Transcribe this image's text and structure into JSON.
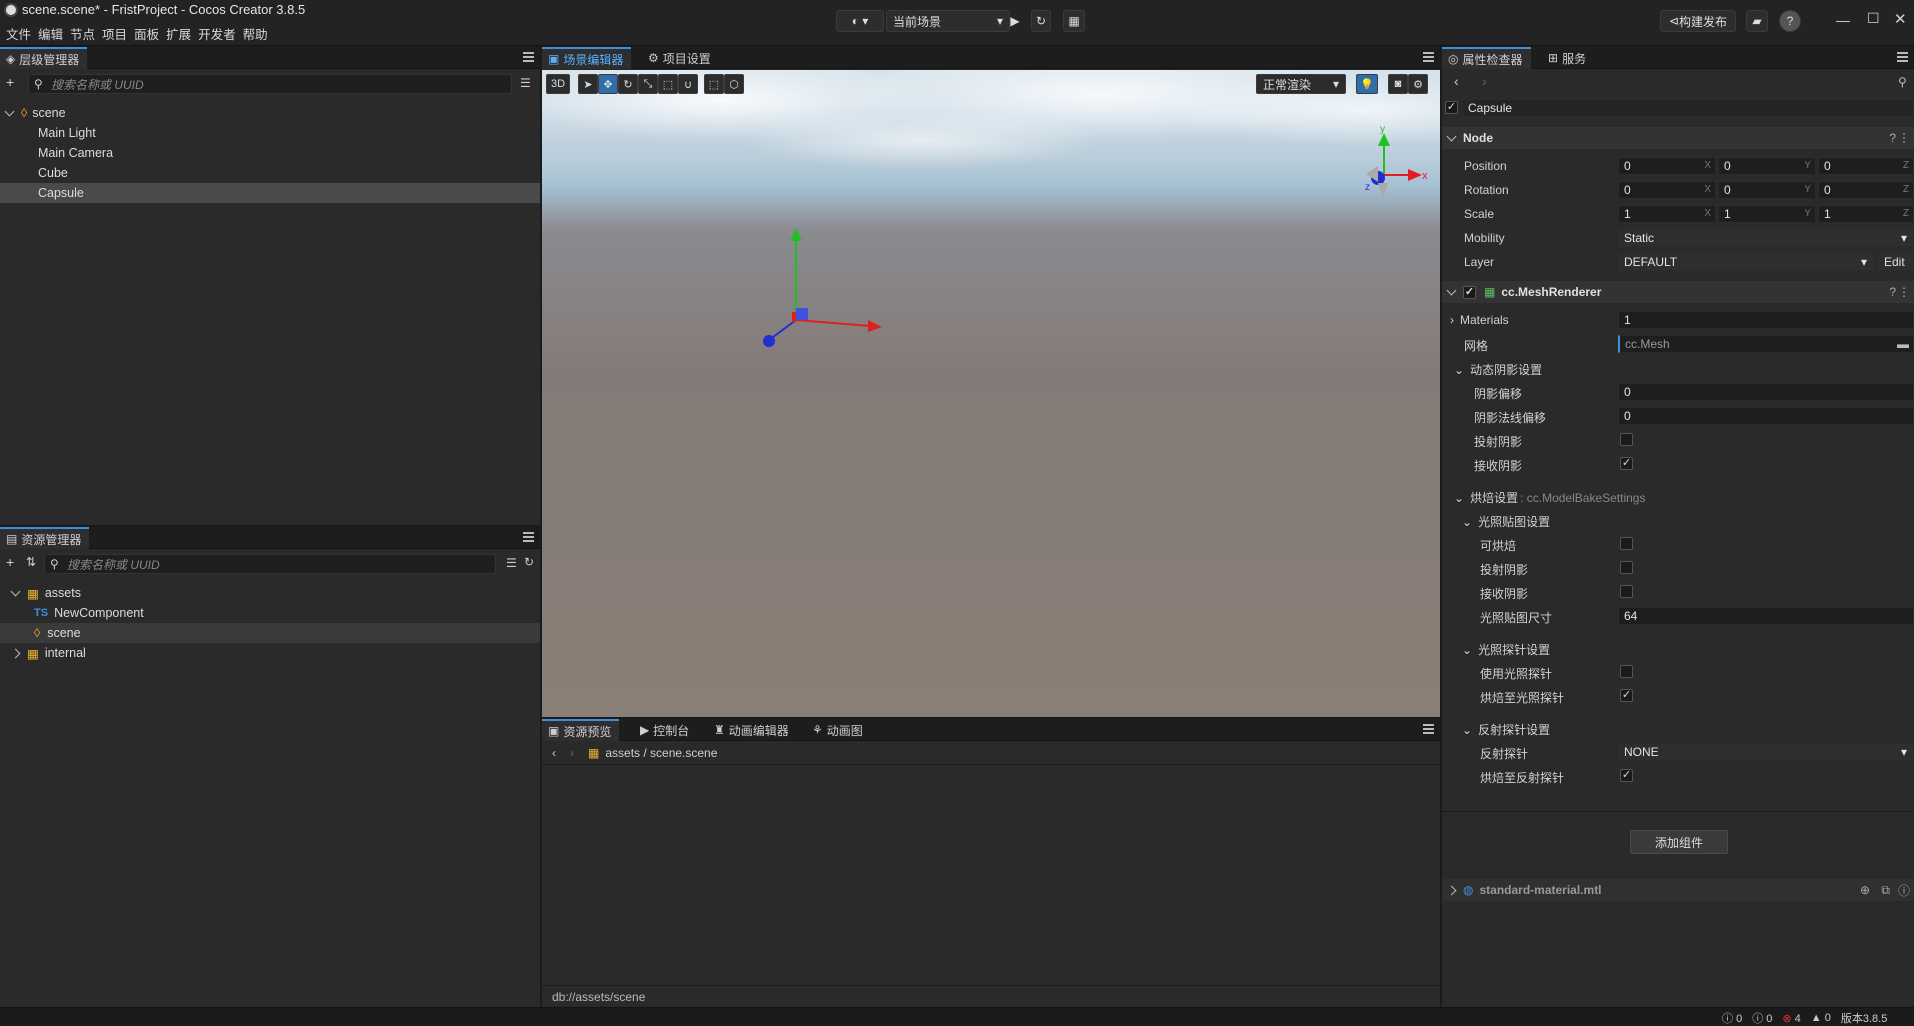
{
  "window": {
    "title": "scene.scene* - FristProject - Cocos Creator 3.8.5"
  },
  "menu": [
    "文件",
    "编辑",
    "节点",
    "项目",
    "面板",
    "扩展",
    "开发者",
    "帮助"
  ],
  "toolbar": {
    "scene_select": "当前场景",
    "build_label": "构建发布",
    "help": "?"
  },
  "hierarchy": {
    "tab": "层级管理器",
    "search_placeholder": "搜索名称或 UUID",
    "root": "scene",
    "items": [
      "Main Light",
      "Main Camera",
      "Cube",
      "Capsule"
    ],
    "selected": "Capsule"
  },
  "assets": {
    "tab": "资源管理器",
    "search_placeholder": "搜索名称或 UUID",
    "root": "assets",
    "items": [
      {
        "type": "TS",
        "label": "NewComponent"
      },
      {
        "type": "scene",
        "label": "scene"
      }
    ],
    "internal": "internal"
  },
  "scene_editor": {
    "tabs": [
      "场景编辑器",
      "项目设置"
    ],
    "mode_3d": "3D",
    "render_mode": "正常渲染",
    "gizmo_axes": {
      "x": "x",
      "y": "y",
      "z": "z"
    }
  },
  "bottom_panel": {
    "tabs": [
      "资源预览",
      "控制台",
      "动画编辑器",
      "动画图"
    ],
    "path": "assets / scene.scene",
    "status_path": "db://assets/scene"
  },
  "inspector": {
    "tabs": [
      "属性检查器",
      "服务"
    ],
    "node_name": "Capsule",
    "node_section": "Node",
    "position": {
      "label": "Position",
      "x": "0",
      "y": "0",
      "z": "0"
    },
    "rotation": {
      "label": "Rotation",
      "x": "0",
      "y": "0",
      "z": "0"
    },
    "scale": {
      "label": "Scale",
      "x": "1",
      "y": "1",
      "z": "1"
    },
    "mobility": {
      "label": "Mobility",
      "value": "Static"
    },
    "layer": {
      "label": "Layer",
      "value": "DEFAULT",
      "edit": "Edit"
    },
    "mesh_renderer": {
      "title": "cc.MeshRenderer",
      "materials_label": "Materials",
      "materials_value": "1",
      "mesh_label": "网格",
      "mesh_value": "cc.Mesh",
      "dynamic_shadow": "动态阴影设置",
      "shadow_bias_label": "阴影偏移",
      "shadow_bias": "0",
      "shadow_normal_bias_label": "阴影法线偏移",
      "shadow_normal_bias": "0",
      "cast_shadow_label": "投射阴影",
      "cast_shadow": false,
      "receive_shadow_label": "接收阴影",
      "receive_shadow": true,
      "bake_label": "烘焙设置",
      "bake_type": ": cc.ModelBakeSettings",
      "lightmap_settings": "光照贴图设置",
      "bakeable_label": "可烘焙",
      "bakeable": false,
      "lm_cast_label": "投射阴影",
      "lm_cast": false,
      "lm_receive_label": "接收阴影",
      "lm_receive": false,
      "lm_size_label": "光照贴图尺寸",
      "lm_size": "64",
      "probe_settings": "光照探针设置",
      "use_probe_label": "使用光照探针",
      "use_probe": false,
      "bake_to_probe_label": "烘焙至光照探针",
      "bake_to_probe": true,
      "reflection_settings": "反射探针设置",
      "reflection_probe_label": "反射探针",
      "reflection_probe": "NONE",
      "bake_to_reflection_label": "烘焙至反射探针",
      "bake_to_reflection": true
    },
    "add_component": "添加组件",
    "material": "standard-material.mtl"
  },
  "statusbar": {
    "info": "0",
    "warn": "0",
    "error": "4",
    "notice": "0",
    "version": "版本3.8.5"
  },
  "colors": {
    "accent": "#3c8fd8",
    "selected_row": "#4a4a4a",
    "x_axis": "#e02020",
    "y_axis": "#20c020",
    "z_axis": "#2030d0"
  }
}
